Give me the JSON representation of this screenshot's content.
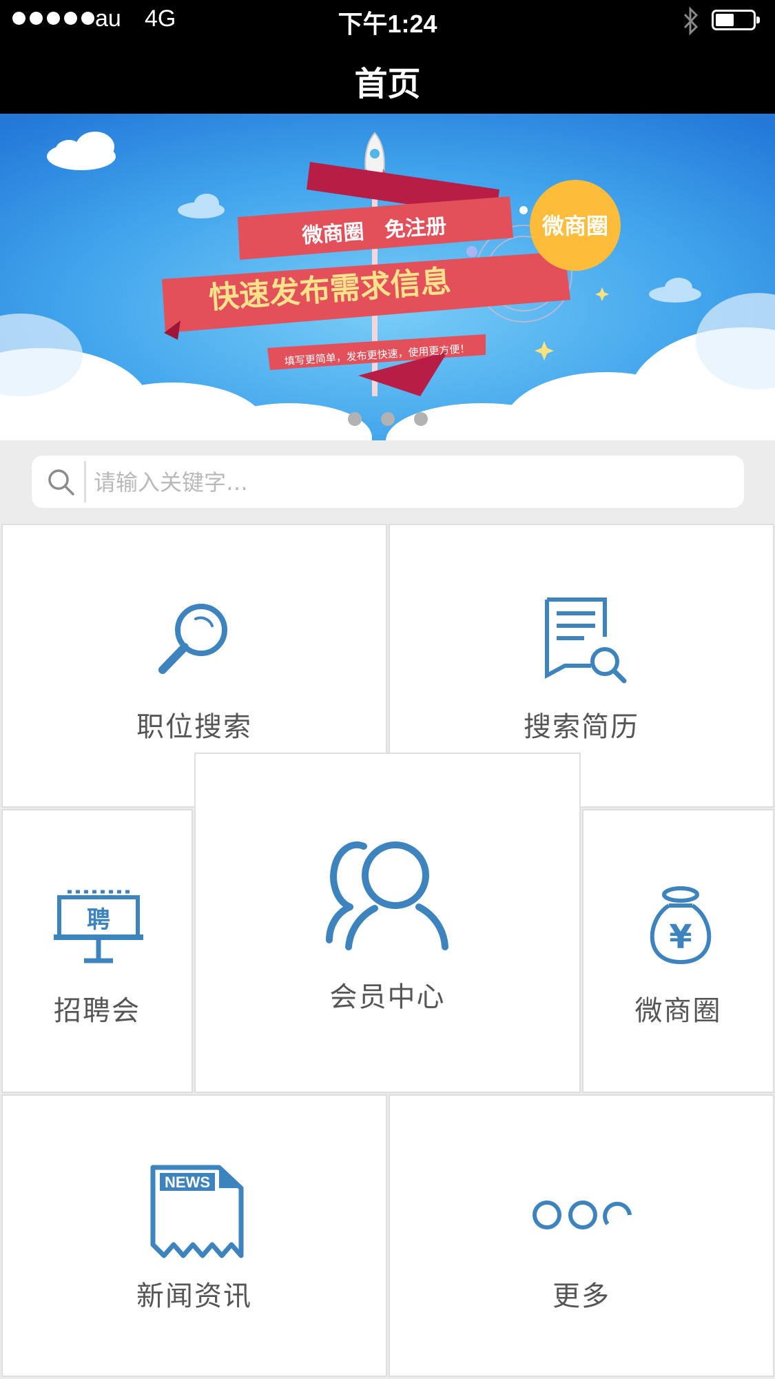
{
  "status_bar": {
    "carrier": "au",
    "network": "4G",
    "time": "下午1:24",
    "battery_level": 0.5
  },
  "nav": {
    "title": "首页"
  },
  "banner": {
    "ribbon_top": "微商圈　免注册",
    "ribbon_main": "快速发布需求信息",
    "ribbon_sub": "填写更简单，发布更快速，使用更方便！",
    "badge": "微商圈",
    "slide_count": 3
  },
  "search": {
    "placeholder": "请输入关键字…",
    "value": ""
  },
  "tiles": {
    "job_search": "职位搜索",
    "resume_search": "搜索简历",
    "job_fair": "招聘会",
    "member_center": "会员中心",
    "wechat_circle": "微商圈",
    "news": "新闻资讯",
    "more": "更多"
  },
  "icon_text": {
    "job_fair_sign": "聘",
    "news_paper": "NEWS",
    "currency": "¥"
  },
  "colors": {
    "icon_blue": "#3d84bf",
    "label_gray": "#555555",
    "ribbon_red": "#e4505a",
    "sky_blue": "#3d9de8"
  }
}
